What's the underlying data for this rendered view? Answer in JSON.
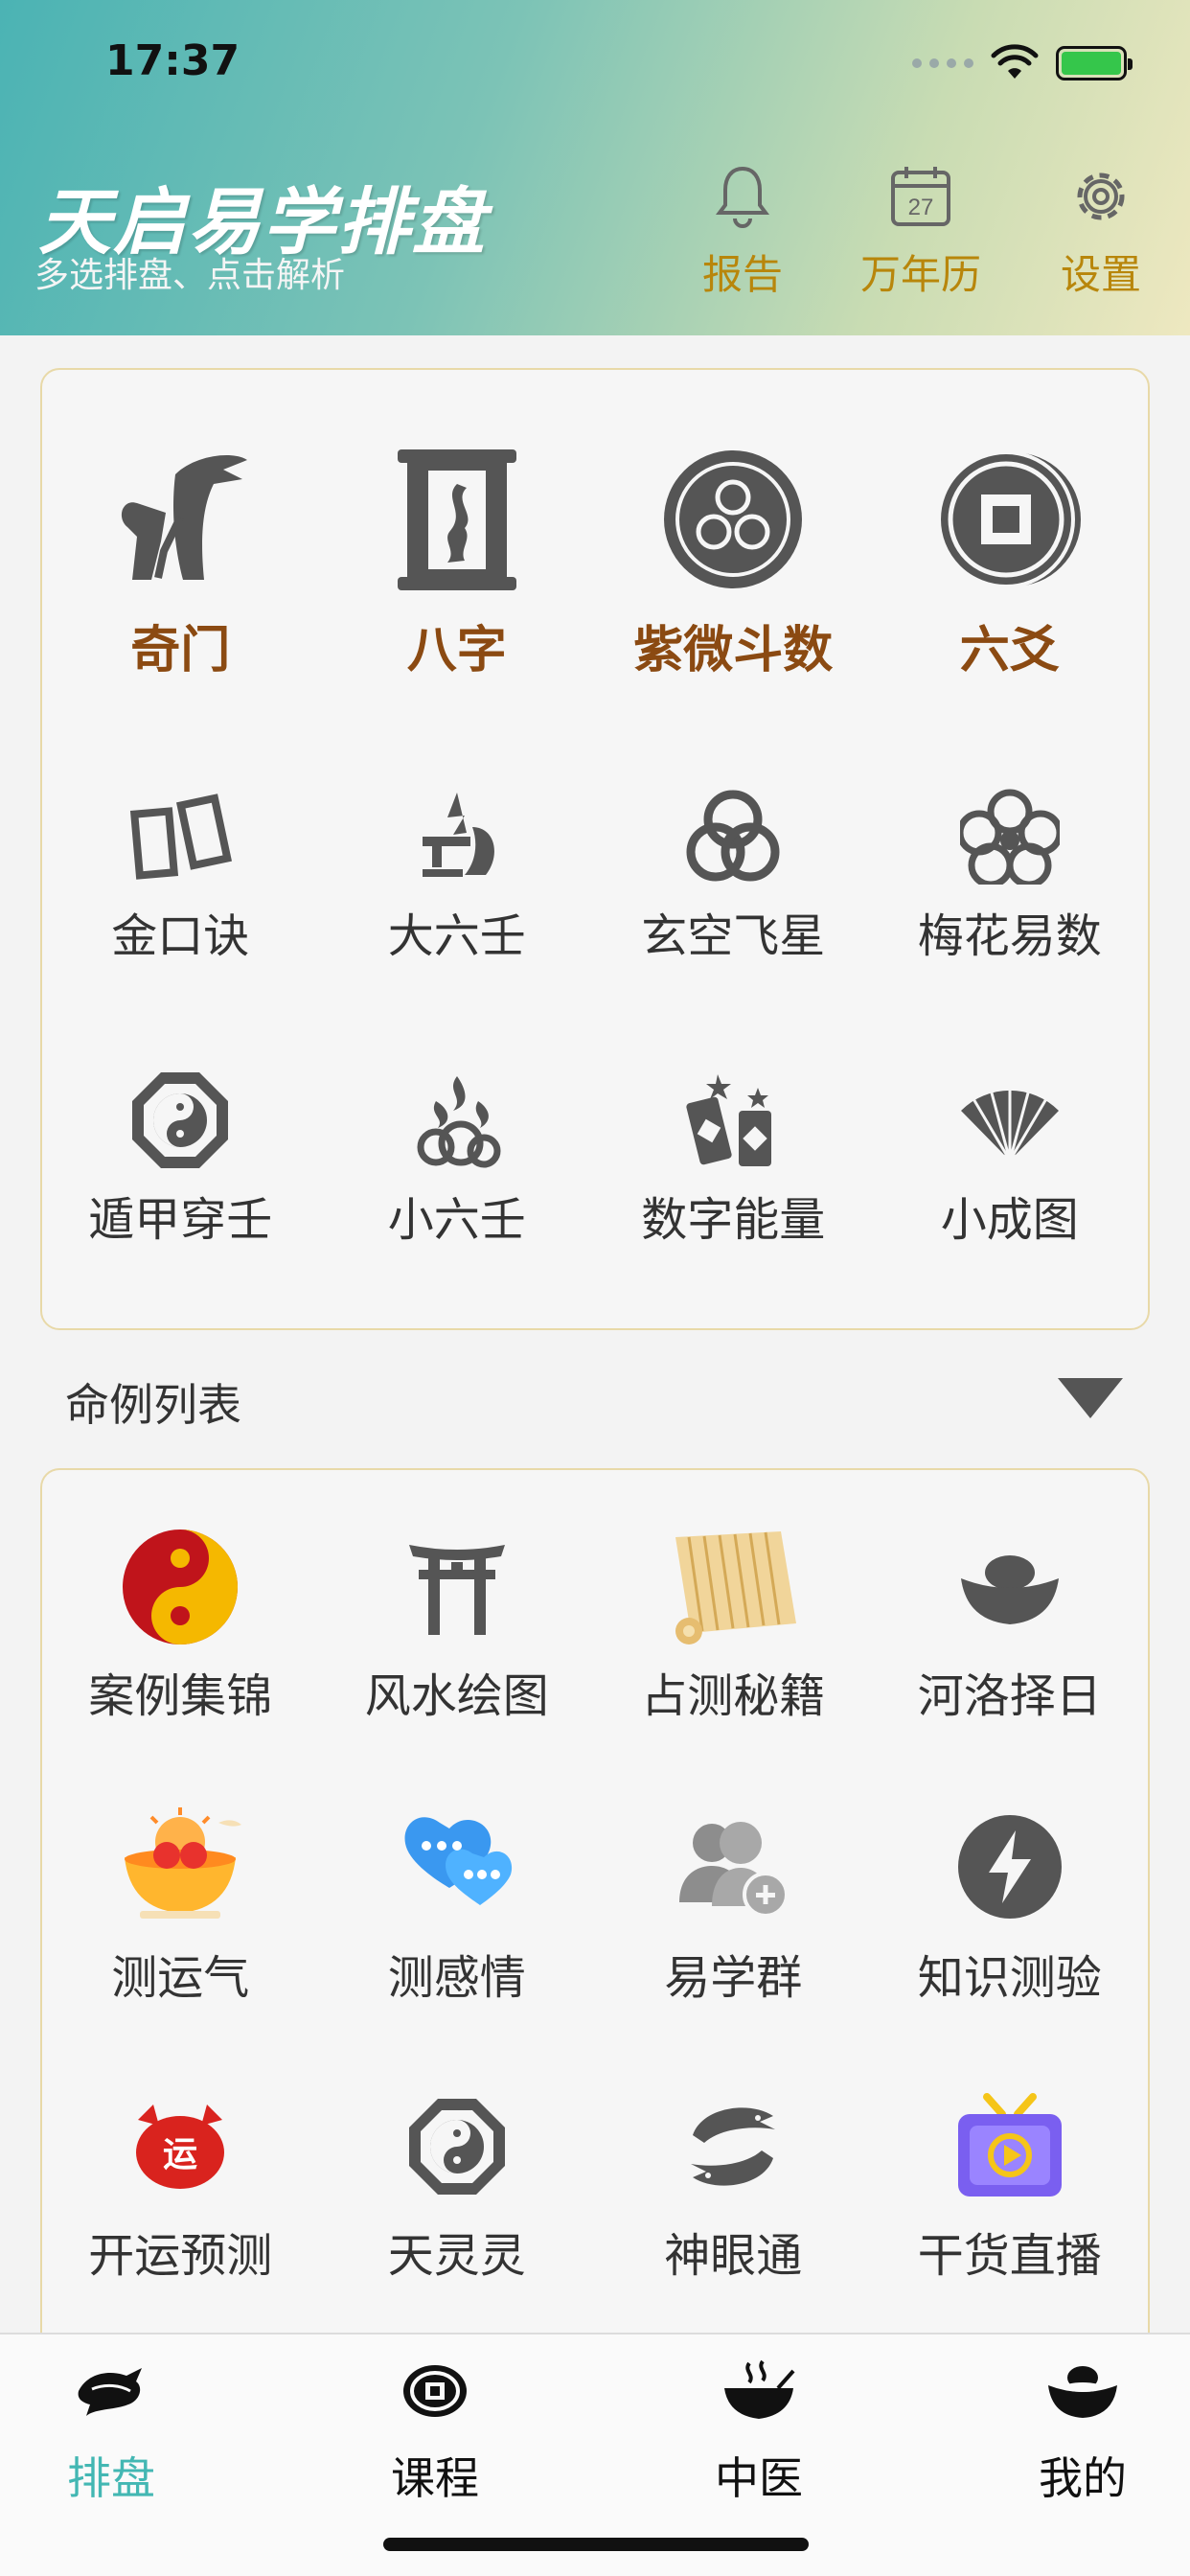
{
  "status_bar": {
    "time": "17:37"
  },
  "header": {
    "title": "天启易学排盘",
    "subtitle": "多选排盘、点击解析",
    "actions": [
      {
        "label": "报告",
        "icon": "bell-icon"
      },
      {
        "label": "万年历",
        "icon": "calendar-icon",
        "calendar_day": "27"
      },
      {
        "label": "设置",
        "icon": "gear-icon"
      }
    ]
  },
  "main_grid": {
    "row1": [
      {
        "label": "奇门",
        "icon": "qimen-figure-icon"
      },
      {
        "label": "八字",
        "icon": "scroll-fish-icon"
      },
      {
        "label": "紫微斗数",
        "icon": "triple-spiral-disc-icon"
      },
      {
        "label": "六爻",
        "icon": "square-hole-coin-icon"
      }
    ],
    "row2": [
      {
        "label": "金口诀",
        "icon": "cards-icon"
      },
      {
        "label": "大六壬",
        "icon": "figure-bowl-icon"
      },
      {
        "label": "玄空飞星",
        "icon": "interlocked-rings-icon"
      },
      {
        "label": "梅花易数",
        "icon": "plum-blossom-icon"
      }
    ],
    "row3": [
      {
        "label": "遁甲穿壬",
        "icon": "bagua-icon"
      },
      {
        "label": "小六壬",
        "icon": "flame-cloud-icon"
      },
      {
        "label": "数字能量",
        "icon": "firecracker-icon"
      },
      {
        "label": "小成图",
        "icon": "folding-fan-icon"
      }
    ]
  },
  "section": {
    "title": "命例列表"
  },
  "tools_grid": {
    "row1": [
      {
        "label": "案例集锦",
        "icon": "yin-yang-icon"
      },
      {
        "label": "风水绘图",
        "icon": "torii-gate-icon"
      },
      {
        "label": "占测秘籍",
        "icon": "bamboo-scroll-icon"
      },
      {
        "label": "河洛择日",
        "icon": "gold-ingot-icon"
      }
    ],
    "row2": [
      {
        "label": "测运气",
        "icon": "treasure-bowl-icon"
      },
      {
        "label": "测感情",
        "icon": "chat-hearts-icon"
      },
      {
        "label": "易学群",
        "icon": "add-group-icon"
      },
      {
        "label": "知识测验",
        "icon": "lightning-icon"
      }
    ],
    "row3": [
      {
        "label": "开运预测",
        "icon": "fortune-badge-icon",
        "badge_text": "运"
      },
      {
        "label": "天灵灵",
        "icon": "bagua-icon"
      },
      {
        "label": "神眼通",
        "icon": "twin-fish-icon"
      },
      {
        "label": "干货直播",
        "icon": "tv-play-icon"
      }
    ]
  },
  "tabbar": {
    "tabs": [
      {
        "label": "排盘",
        "icon": "dragon-icon",
        "active": true
      },
      {
        "label": "课程",
        "icon": "coin-icon",
        "active": false
      },
      {
        "label": "中医",
        "icon": "herb-bowl-icon",
        "active": false
      },
      {
        "label": "我的",
        "icon": "treasure-bowl-icon",
        "active": false
      }
    ]
  },
  "colors": {
    "accent_teal": "#43b7b3",
    "brown_label": "#8b4a12",
    "gold_label": "#b8860b",
    "panel_border": "#e8d9a8"
  }
}
